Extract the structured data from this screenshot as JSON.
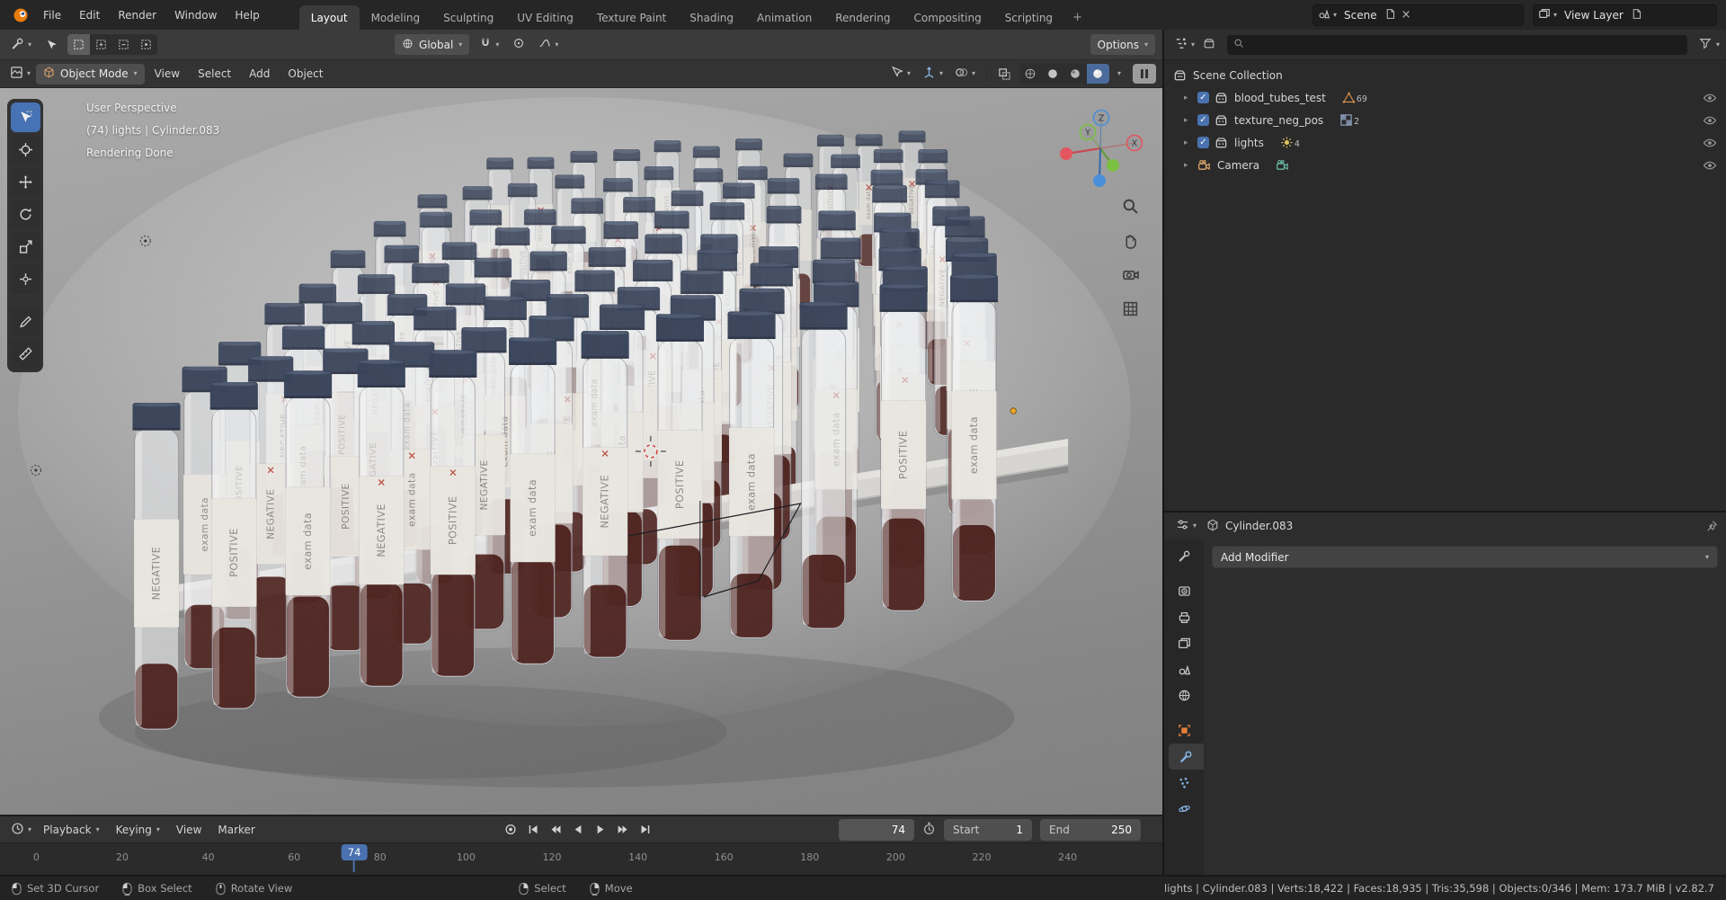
{
  "colors": {
    "accent_blue": "#4772b3",
    "object_orange": "#e77e38",
    "axis_x": "#e4555f",
    "axis_y": "#7cc043",
    "axis_z": "#4a90d9",
    "tube_cap": "#333e55",
    "tube_blood": "#441511",
    "tray": "#d8d7d3"
  },
  "topbar": {
    "menus": [
      {
        "label": "File"
      },
      {
        "label": "Edit"
      },
      {
        "label": "Render"
      },
      {
        "label": "Window"
      },
      {
        "label": "Help"
      }
    ],
    "tabs": [
      {
        "label": "Layout",
        "active": true
      },
      {
        "label": "Modeling"
      },
      {
        "label": "Sculpting"
      },
      {
        "label": "UV Editing"
      },
      {
        "label": "Texture Paint"
      },
      {
        "label": "Shading"
      },
      {
        "label": "Animation"
      },
      {
        "label": "Rendering"
      },
      {
        "label": "Compositing"
      },
      {
        "label": "Scripting"
      }
    ],
    "add_tab": "+",
    "scene": {
      "label": "Scene"
    },
    "view_layer": {
      "label": "View Layer"
    }
  },
  "tool_settings": {
    "orientation": "Global",
    "options": "Options"
  },
  "viewport_header": {
    "mode": "Object Mode",
    "menus": [
      {
        "label": "View"
      },
      {
        "label": "Select"
      },
      {
        "label": "Add"
      },
      {
        "label": "Object"
      }
    ]
  },
  "viewport": {
    "overlay_lines": [
      "User Perspective",
      "(74) lights | Cylinder.083",
      "Rendering Done"
    ],
    "axes": {
      "x": "X",
      "y": "Y",
      "z": "Z"
    },
    "tube_labels": [
      "POSITIVE",
      "NEGATIVE",
      "exam data"
    ]
  },
  "outliner": {
    "rows": [
      {
        "icon": "scene-collection",
        "label": "Scene Collection"
      },
      {
        "class": "child",
        "arrow": "▸",
        "checked": true,
        "icon": "collection",
        "label": "blood_tubes_test",
        "badge_icon": "mesh-data",
        "badge_count": "69",
        "eye": true
      },
      {
        "class": "child",
        "arrow": "▸",
        "checked": true,
        "icon": "collection",
        "label": "texture_neg_pos",
        "badge_icon": "texture-data",
        "badge_count": "2",
        "eye": true
      },
      {
        "class": "child",
        "arrow": "▸",
        "checked": true,
        "icon": "collection",
        "label": "lights",
        "badge_icon": "light-data",
        "badge_count": "4",
        "eye": true
      },
      {
        "class": "child",
        "arrow": "▸",
        "icon": "camera-object",
        "label": "Camera",
        "badge_icon": "camera-data",
        "eye": true
      }
    ]
  },
  "properties": {
    "breadcrumb": "Cylinder.083",
    "add_modifier": "Add Modifier",
    "tabs": [
      {
        "icon": "tool"
      },
      {
        "icon": "render",
        "class": "gap"
      },
      {
        "icon": "output"
      },
      {
        "icon": "view-layer"
      },
      {
        "icon": "scene"
      },
      {
        "icon": "world"
      },
      {
        "icon": "object",
        "class": "gap"
      },
      {
        "icon": "modifiers",
        "active": true
      },
      {
        "icon": "particles"
      },
      {
        "icon": "physics"
      }
    ]
  },
  "timeline": {
    "menus": [
      {
        "label": "Playback",
        "dd": true
      },
      {
        "label": "Keying",
        "dd": true
      },
      {
        "label": "View"
      },
      {
        "label": "Marker"
      }
    ],
    "transport": [
      {
        "icon": "jump-start"
      },
      {
        "icon": "prev-key"
      },
      {
        "icon": "play-back"
      },
      {
        "icon": "play"
      },
      {
        "icon": "next-key"
      },
      {
        "icon": "jump-end"
      }
    ],
    "current_frame": "74",
    "playhead_frame": 74,
    "start_label": "Start",
    "start_value": "1",
    "end_label": "End",
    "end_value": "250",
    "ticks": [
      "0",
      "20",
      "40",
      "60",
      "80",
      "100",
      "120",
      "140",
      "160",
      "180",
      "200",
      "220",
      "240"
    ]
  },
  "statusbar": {
    "hints_left": [
      {
        "icon": "mouse-left",
        "label": "Set 3D Cursor"
      },
      {
        "icon": "mouse-left-drag",
        "label": "Box Select"
      },
      {
        "icon": "mouse-middle",
        "label": "Rotate View"
      }
    ],
    "hints_right": [
      {
        "icon": "mouse-right",
        "label": "Select"
      },
      {
        "icon": "mouse-right-drag",
        "label": "Move"
      }
    ],
    "info": "lights | Cylinder.083 | Verts:18,422 | Faces:18,935 | Tris:35,598 | Objects:0/346 | Mem: 173.7 MiB | v2.82.7"
  }
}
